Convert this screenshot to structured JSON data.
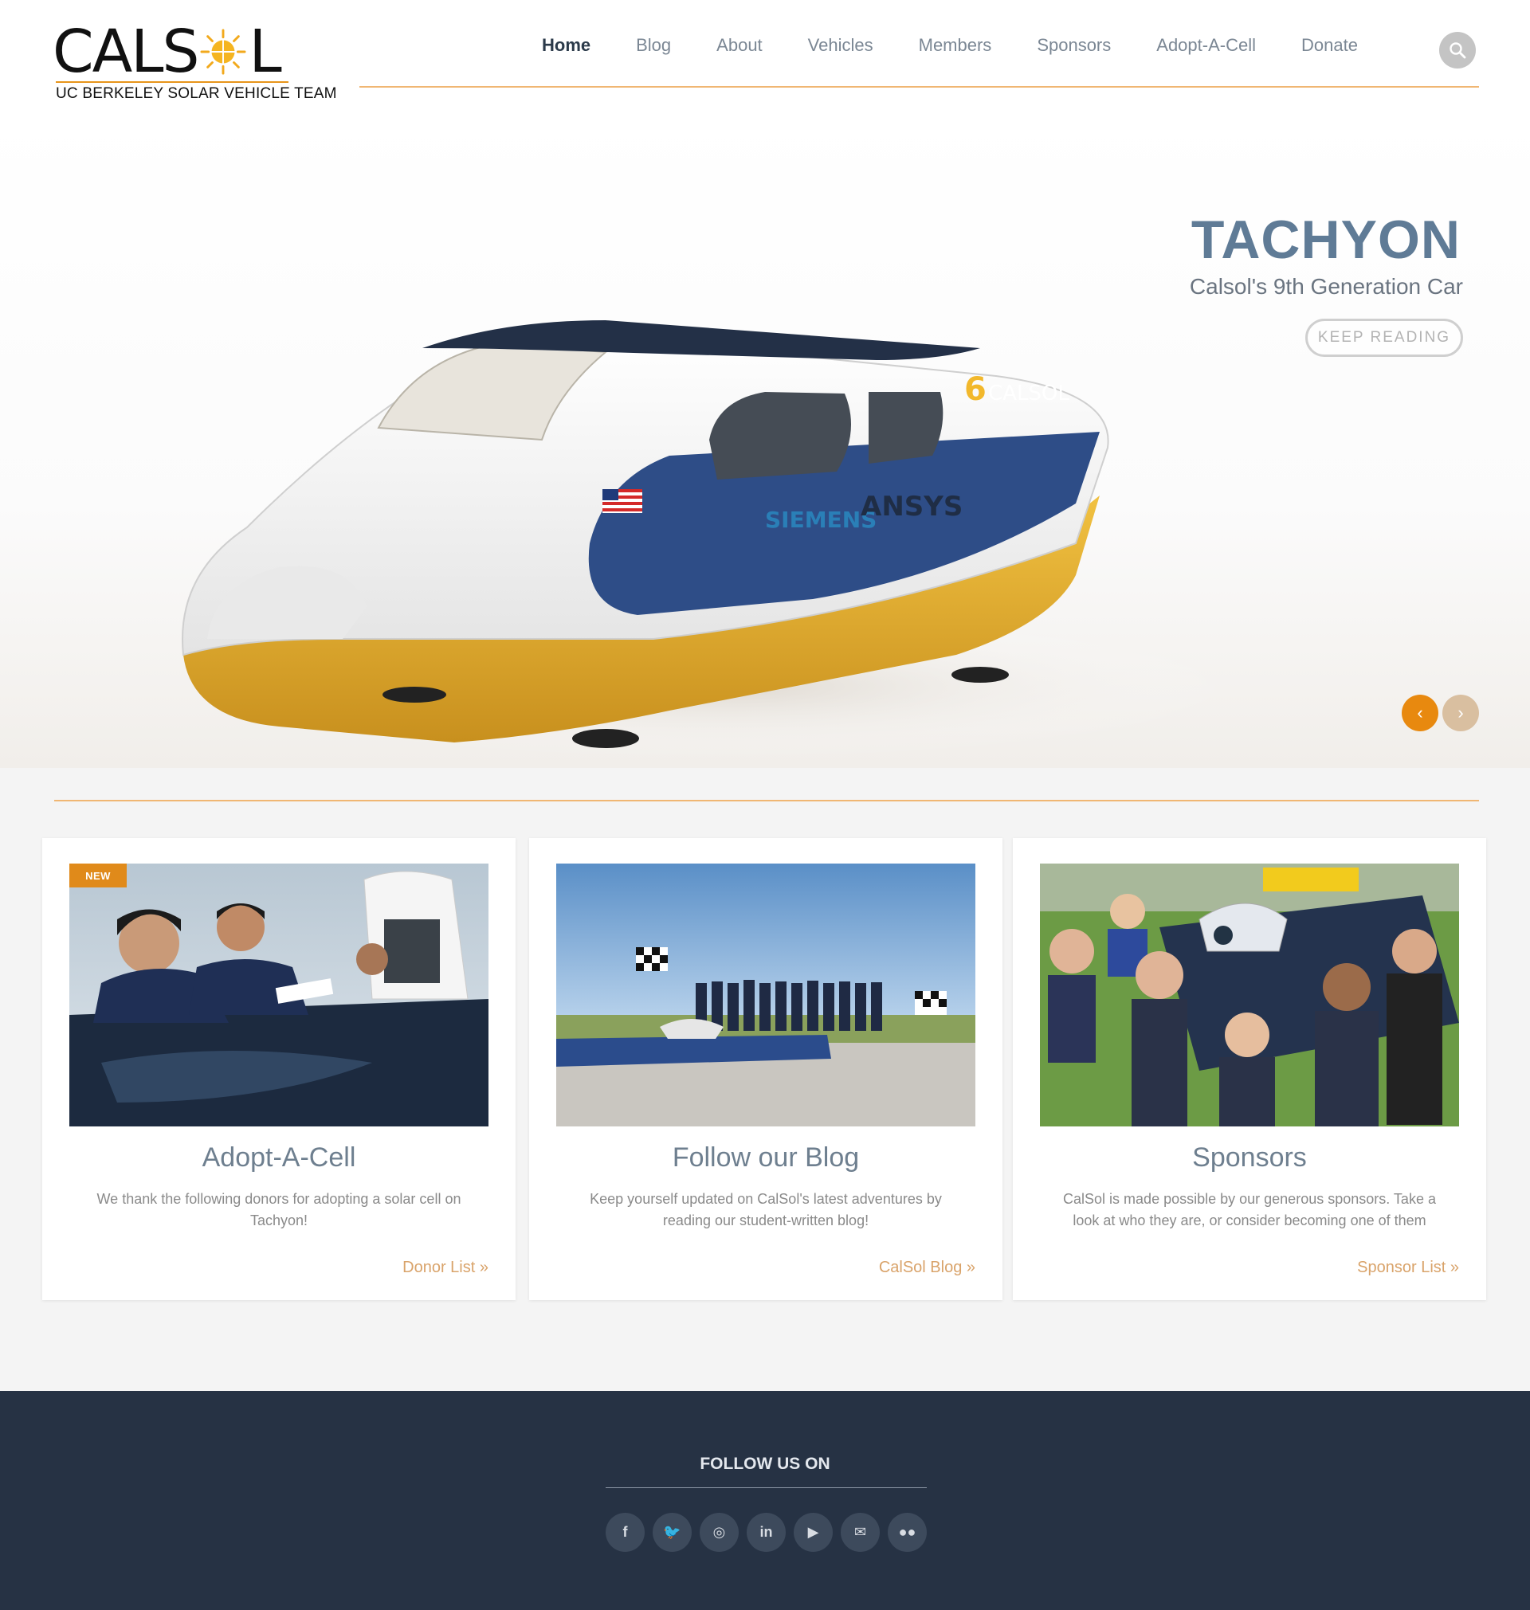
{
  "header": {
    "logo_word_left": "CALS",
    "logo_word_right": "L",
    "logo_tagline": "UC BERKELEY SOLAR VEHICLE TEAM",
    "nav": [
      {
        "label": "Home",
        "active": true
      },
      {
        "label": "Blog"
      },
      {
        "label": "About"
      },
      {
        "label": "Vehicles"
      },
      {
        "label": "Members"
      },
      {
        "label": "Sponsors"
      },
      {
        "label": "Adopt-A-Cell"
      },
      {
        "label": "Donate"
      }
    ],
    "search_icon": "search-icon"
  },
  "hero": {
    "title": "TACHYON",
    "subtitle": "Calsol's 9th Generation Car",
    "button": "KEEP READING",
    "prev_arrow": "‹",
    "next_arrow": "›"
  },
  "cards": [
    {
      "badge": "NEW",
      "title": "Adopt-A-Cell",
      "text": "We thank the following donors for adopting a solar cell on Tachyon!",
      "link": "Donor List »"
    },
    {
      "title": "Follow our Blog",
      "text": "Keep yourself updated on CalSol's latest adventures by reading our student-written blog!",
      "link": "CalSol Blog »"
    },
    {
      "title": "Sponsors",
      "text": "CalSol is made possible by our generous sponsors. Take a look at who they are, or consider becoming one of them",
      "link": "Sponsor List »"
    }
  ],
  "footer": {
    "title": "FOLLOW US ON",
    "socials": [
      {
        "icon": "facebook-icon",
        "glyph": "f"
      },
      {
        "icon": "twitter-icon",
        "glyph": "🐦"
      },
      {
        "icon": "instagram-icon",
        "glyph": "◎"
      },
      {
        "icon": "linkedin-icon",
        "glyph": "in"
      },
      {
        "icon": "youtube-icon",
        "glyph": "▶"
      },
      {
        "icon": "email-icon",
        "glyph": "✉"
      },
      {
        "icon": "flickr-icon",
        "glyph": "●●"
      }
    ]
  },
  "colors": {
    "accent": "#e8890f",
    "rule": "#f0b673",
    "hero_title": "#5f7b96",
    "footer_bg": "#263244",
    "link": "#d9a36a"
  }
}
